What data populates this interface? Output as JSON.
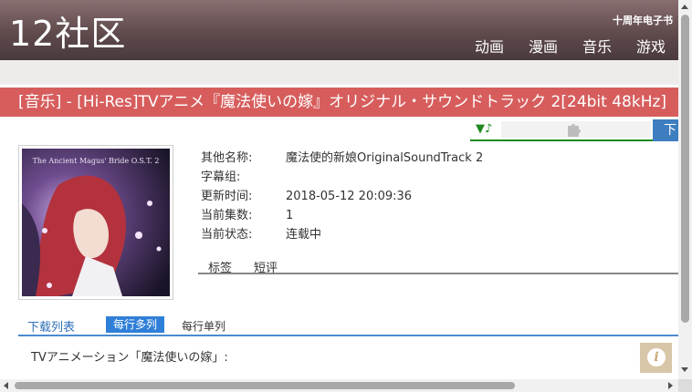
{
  "header": {
    "logo": "12社区",
    "promo": "十周年电子书",
    "nav": [
      "动画",
      "漫画",
      "音乐",
      "游戏"
    ]
  },
  "title": "[音乐] - [Hi-Res]TVアニメ『魔法使いの嫁』オリジナル・サウンドトラック 2[24bit 48kHz]",
  "player": {
    "play_icon": "▼♪",
    "plugin_icon": "puzzle-icon"
  },
  "download_button": "下",
  "cover": {
    "text": "The Ancient Magus' Bride O.S.T. 2"
  },
  "info": [
    {
      "label": "其他名称:",
      "value": "魔法使的新娘OriginalSoundTrack 2"
    },
    {
      "label": "字幕组:",
      "value": ""
    },
    {
      "label": "更新时间:",
      "value": "2018-05-12 20:09:36"
    },
    {
      "label": "当前集数:",
      "value": "1"
    },
    {
      "label": "当前状态:",
      "value": "连载中"
    }
  ],
  "subtabs": [
    "标签",
    "短评"
  ],
  "download": {
    "title": "下载列表",
    "multi": "每行多列",
    "single": "每行单列"
  },
  "description": "TVアニメーション「魔法使いの嫁」:",
  "info_button": "i",
  "colors": {
    "header": "#5f4a4c",
    "title_bar": "#d75d5d",
    "accent_blue": "#2f7fd8",
    "player_green": "#1e8a1e"
  }
}
